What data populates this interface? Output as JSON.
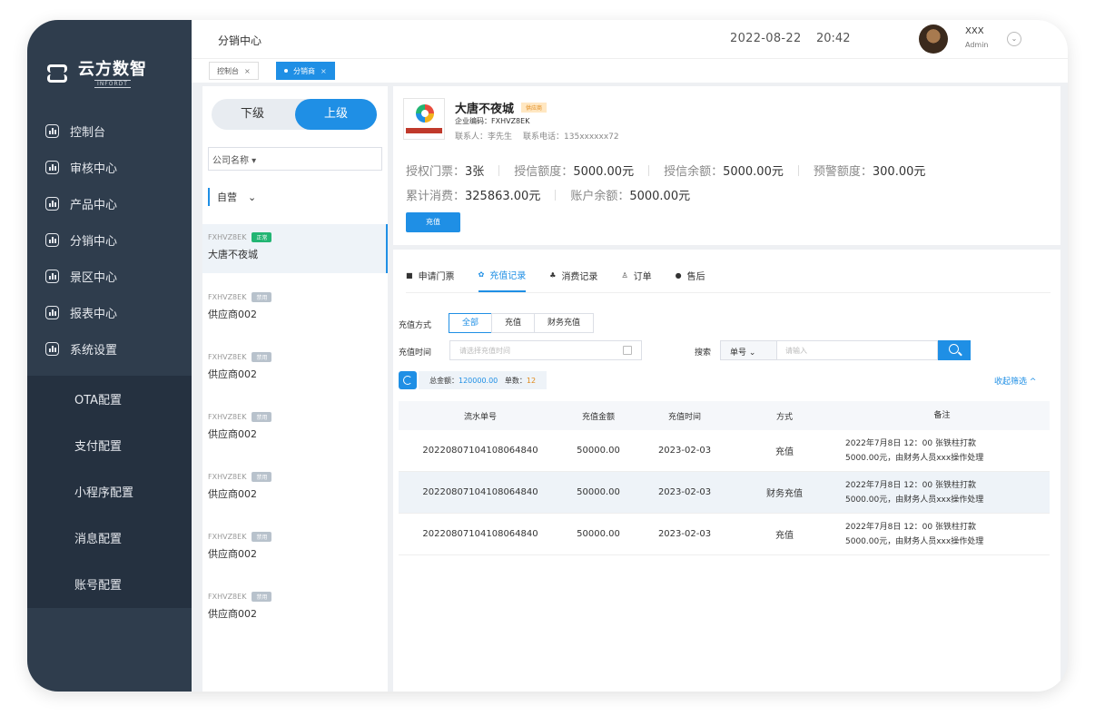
{
  "sidebar": {
    "logo_cn": "云方数智",
    "logo_en": "INFORDT",
    "menu": [
      {
        "label": "控制台"
      },
      {
        "label": "审核中心"
      },
      {
        "label": "产品中心"
      },
      {
        "label": "分销中心"
      },
      {
        "label": "景区中心"
      },
      {
        "label": "报表中心"
      },
      {
        "label": "系统设置"
      }
    ],
    "submenu": [
      {
        "label": "OTA配置"
      },
      {
        "label": "支付配置"
      },
      {
        "label": "小程序配置"
      },
      {
        "label": "消息配置"
      },
      {
        "label": "账号配置"
      }
    ]
  },
  "header": {
    "title": "分销中心",
    "date": "2022-08-22",
    "time": "20:42",
    "user_name": "XXX",
    "user_role": "Admin"
  },
  "tabs": [
    {
      "label": "控制台",
      "close": "×"
    },
    {
      "label": "分销商",
      "close": "×"
    }
  ],
  "list_panel": {
    "seg_lower": "下级",
    "seg_upper": "上级",
    "company_filter": "公司名称 ▾",
    "group_filter": "自营",
    "group_chevron": "⌄",
    "items": [
      {
        "code": "FXHVZ8EK",
        "badge": "正常",
        "name": "大唐不夜城"
      },
      {
        "code": "FXHVZ8EK",
        "badge": "禁用",
        "name": "供应商002"
      },
      {
        "code": "FXHVZ8EK",
        "badge": "禁用",
        "name": "供应商002"
      },
      {
        "code": "FXHVZ8EK",
        "badge": "禁用",
        "name": "供应商002"
      },
      {
        "code": "FXHVZ8EK",
        "badge": "禁用",
        "name": "供应商002"
      },
      {
        "code": "FXHVZ8EK",
        "badge": "禁用",
        "name": "供应商002"
      },
      {
        "code": "FXHVZ8EK",
        "badge": "禁用",
        "name": "供应商002"
      }
    ]
  },
  "company": {
    "name": "大唐不夜城",
    "tag": "供应商",
    "code": "企业编码：FXHVZ8EK",
    "contact": "联系人：李先生",
    "phone": "联系电话：135xxxxxx72",
    "stats_row1": [
      {
        "label": "授权门票：",
        "value": "3张"
      },
      {
        "label": "授信额度：",
        "value": "5000.00元"
      },
      {
        "label": "授信余额：",
        "value": "5000.00元"
      },
      {
        "label": "预警额度：",
        "value": "300.00元"
      }
    ],
    "stats_row2": [
      {
        "label": "累计消费：",
        "value": "325863.00元"
      },
      {
        "label": "账户余额：",
        "value": "5000.00元"
      }
    ],
    "recharge_label": "充值"
  },
  "main": {
    "sub_tabs": [
      {
        "icon": "■",
        "label": "申请门票"
      },
      {
        "icon": "✿",
        "label": "充值记录"
      },
      {
        "icon": "♣",
        "label": "消费记录"
      },
      {
        "icon": "♙",
        "label": "订单"
      },
      {
        "icon": "●",
        "label": "售后"
      }
    ],
    "method_label": "充值方式",
    "methods": [
      "全部",
      "充值",
      "财务充值"
    ],
    "time_label": "充值时间",
    "time_placeholder": "请选择充值时间",
    "search_label": "搜索",
    "search_field": "单号 ⌄",
    "search_placeholder": "请输入",
    "summary_total_label": "总金额：",
    "summary_total": "120000.00",
    "summary_count_label": "单数：",
    "summary_count": "12",
    "collapse_label": "收起筛选 ^",
    "table": {
      "headers": [
        "流水单号",
        "充值金额",
        "充值时间",
        "方式",
        "备注"
      ],
      "rows": [
        {
          "no": "20220807104108064840",
          "amount": "50000.00",
          "time": "2023-02-03",
          "method": "充值",
          "note1": "2022年7月8日 12：00 张铁柱打款",
          "note2": "5000.00元，由财务人员xxx操作处理"
        },
        {
          "no": "20220807104108064840",
          "amount": "50000.00",
          "time": "2023-02-03",
          "method": "财务充值",
          "note1": "2022年7月8日 12：00 张铁柱打款",
          "note2": "5000.00元，由财务人员xxx操作处理"
        },
        {
          "no": "20220807104108064840",
          "amount": "50000.00",
          "time": "2023-02-03",
          "method": "充值",
          "note1": "2022年7月8日 12：00 张铁柱打款",
          "note2": "5000.00元，由财务人员xxx操作处理"
        }
      ]
    }
  },
  "colors": {
    "sidebar": "#2f3d4d",
    "submenu": "#253140",
    "primary": "#1f8fe5",
    "badge_ok": "#22b573",
    "badge_off": "#b8c2cc"
  }
}
